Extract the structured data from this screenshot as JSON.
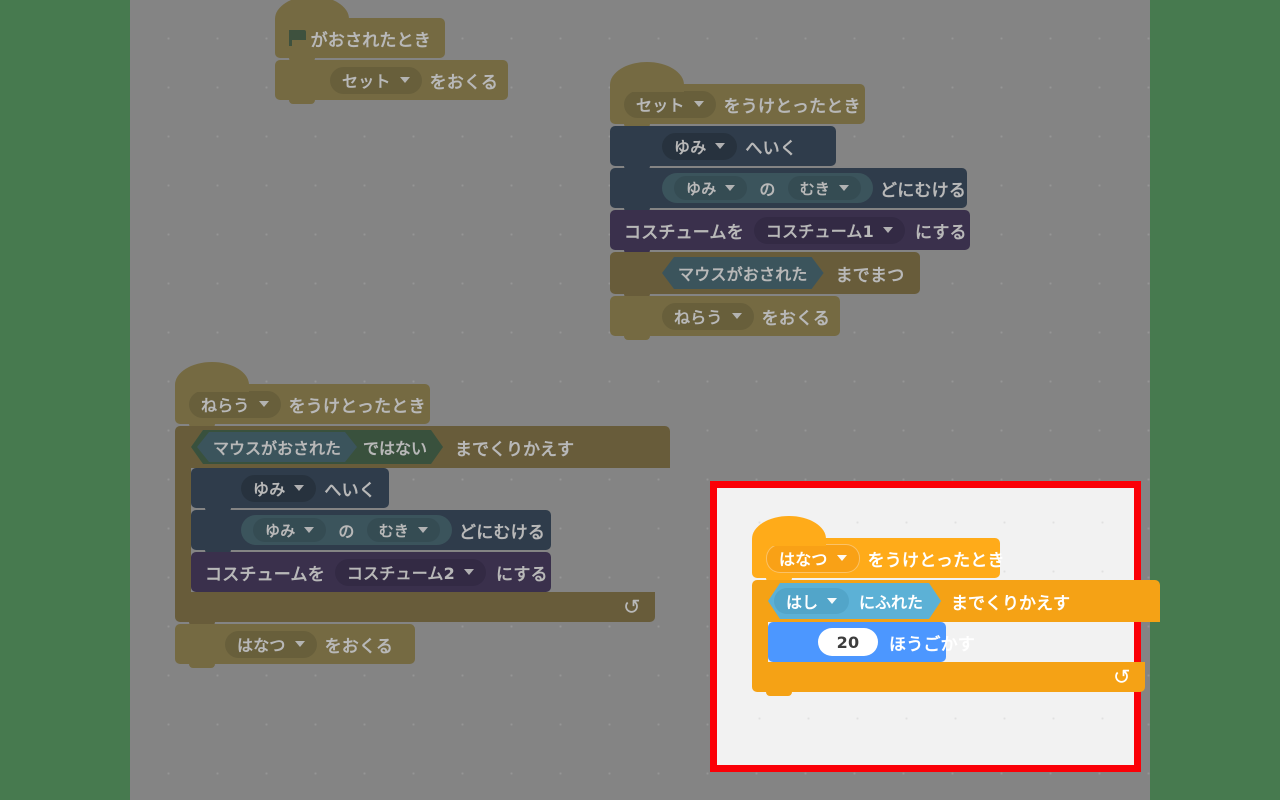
{
  "workspace": {
    "background_color": "#848484",
    "side_band_color": "#477a4f",
    "hint_arrow_name": "right-arrow-hint"
  },
  "palette": {
    "events": "#b89410",
    "events_bright": "#ffab19",
    "events_bright_dark": "#f5a215",
    "motion": "#2b5788",
    "motion_bright": "#4c97ff",
    "looks": "#5b3a99",
    "control": "#a8800f",
    "control_bright": "#ffab19",
    "sensing": "#2b7d99",
    "sensing_bright": "#5cb1d6",
    "operators": "#2e7d3c",
    "input_text": "#3d3d3d",
    "highlight_border": "#fb0007",
    "highlight_background": "#f2f2f2"
  },
  "scripts": {
    "script1": {
      "name": "green-flag-script",
      "hat": {
        "icon": "green-flag-icon",
        "text": "がおされたとき"
      },
      "blocks": [
        {
          "type": "broadcast",
          "dropdown": "セット",
          "text": "をおくる"
        }
      ]
    },
    "script2": {
      "name": "receive-set-script",
      "hat": {
        "dropdown": "セット",
        "text": "をうけとったとき"
      },
      "blocks": [
        {
          "type": "motion-goto",
          "dropdown": "ゆみ",
          "text": "へいく"
        },
        {
          "type": "motion-point",
          "dropdown1": "ゆみ",
          "joiner": "の",
          "dropdown2": "むき",
          "text": "どにむける"
        },
        {
          "type": "looks-costume",
          "prefix": "コスチュームを",
          "dropdown": "コスチューム1",
          "suffix": "にする"
        },
        {
          "type": "control-waituntil",
          "condition": "マウスがおされた",
          "text": "までまつ"
        },
        {
          "type": "broadcast",
          "dropdown": "ねらう",
          "text": "をおくる"
        }
      ]
    },
    "script3": {
      "name": "receive-aim-script",
      "hat": {
        "dropdown": "ねらう",
        "text": "をうけとったとき"
      },
      "loop": {
        "condition_inner": "マウスがおされた",
        "condition_not": "ではない",
        "text": "までくりかえす",
        "loop_arrow": "↻",
        "body": [
          {
            "type": "motion-goto",
            "dropdown": "ゆみ",
            "text": "へいく"
          },
          {
            "type": "motion-point",
            "dropdown1": "ゆみ",
            "joiner": "の",
            "dropdown2": "むき",
            "text": "どにむける"
          },
          {
            "type": "looks-costume",
            "prefix": "コスチュームを",
            "dropdown": "コスチューム2",
            "suffix": "にする"
          }
        ]
      },
      "after_loop": [
        {
          "type": "broadcast",
          "dropdown": "はなつ",
          "text": "をおくる"
        }
      ]
    },
    "script4_highlighted": {
      "name": "receive-fire-script",
      "hat": {
        "dropdown": "はなつ",
        "text": "をうけとったとき"
      },
      "loop": {
        "condition_dropdown": "はし",
        "condition_text": "にふれた",
        "text": "までくりかえす",
        "loop_arrow": "↻",
        "body": [
          {
            "type": "motion-move",
            "value": "20",
            "text": "ほうごかす"
          }
        ]
      }
    }
  }
}
